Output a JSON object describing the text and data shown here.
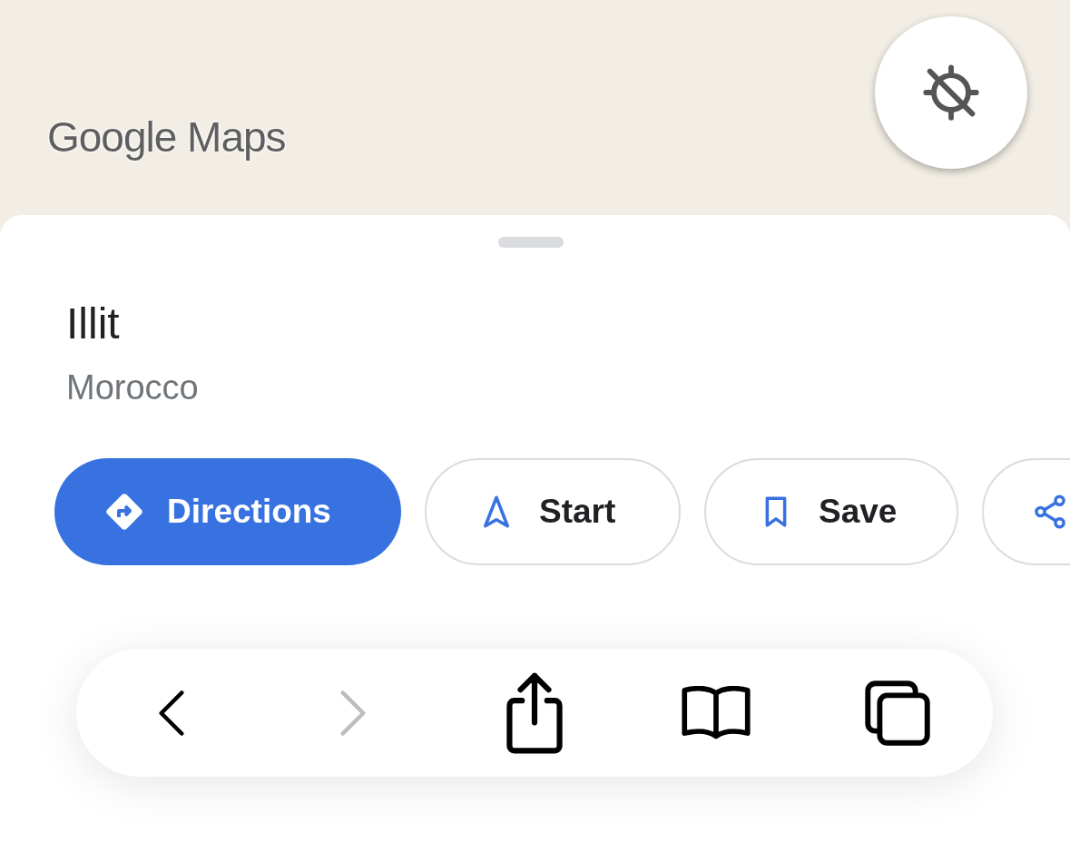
{
  "map": {
    "logo": "Google Maps",
    "location_button": {
      "disabled": true
    }
  },
  "place": {
    "name": "Illit",
    "subtitle": "Morocco"
  },
  "actions": [
    {
      "kind": "primary",
      "label": "Directions"
    },
    {
      "kind": "outline",
      "label": "Start"
    },
    {
      "kind": "outline",
      "label": "Save"
    },
    {
      "kind": "outline"
    }
  ],
  "browser_toolbar": [
    {
      "disabled": false
    },
    {
      "disabled": true
    },
    {
      "disabled": false
    },
    {
      "disabled": false
    },
    {
      "disabled": false
    }
  ]
}
